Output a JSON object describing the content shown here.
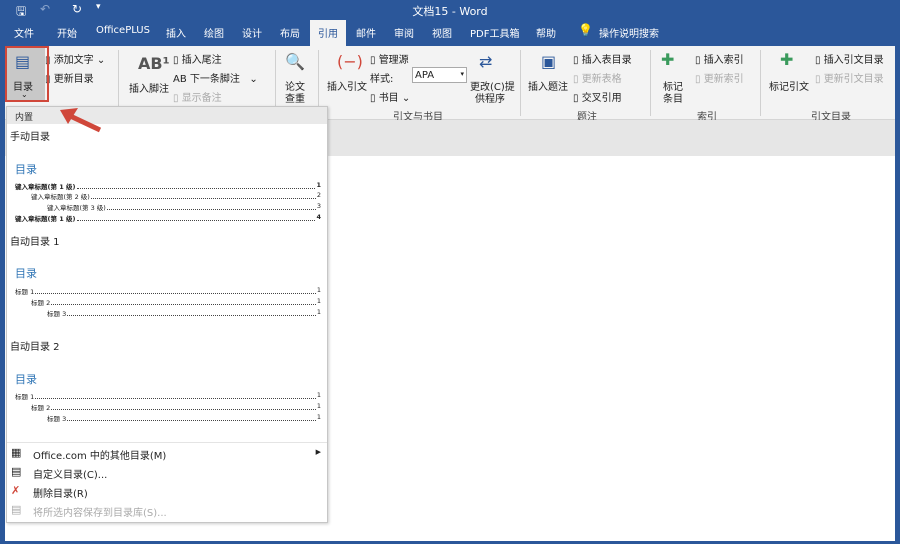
{
  "window": {
    "title": "文档15  -  Word"
  },
  "quick_access": {
    "save": "save-icon",
    "undo": "undo-icon",
    "redo": "redo-icon",
    "customize": "customize-icon"
  },
  "tabs": [
    "文件",
    "开始",
    "OfficePLUS",
    "插入",
    "绘图",
    "设计",
    "布局",
    "引用",
    "邮件",
    "审阅",
    "视图",
    "PDF工具箱",
    "帮助"
  ],
  "active_tab": "引用",
  "search_label": "操作说明搜索",
  "ribbon": {
    "toc": {
      "label": "目录",
      "add_text": "添加文字",
      "update": "更新目录"
    },
    "footnotes": {
      "insert_footnote": "插入脚注",
      "insert_endnote": "插入尾注",
      "next_footnote": "下一条脚注",
      "show_notes": "显示备注"
    },
    "research": {
      "label_1": "论文",
      "label_2": "查重"
    },
    "citations": {
      "insert_citation": "插入引文",
      "manage_sources": "管理源",
      "style_label": "样式:",
      "style_value": "APA",
      "bibliography": "书目",
      "change_1": "更改(C)提",
      "change_2": "供程序",
      "group": "引文与书目"
    },
    "captions": {
      "insert_caption": "插入题注",
      "insert_table_figures": "插入表目录",
      "update_table": "更新表格",
      "cross_ref": "交叉引用",
      "group": "题注"
    },
    "index": {
      "mark_1": "标记",
      "mark_2": "条目",
      "insert_index": "插入索引",
      "update_index": "更新索引",
      "group": "索引"
    },
    "authorities": {
      "mark_citation": "标记引文",
      "insert_toa": "插入引文目录",
      "update_toa": "更新引文目录",
      "group": "引文目录"
    }
  },
  "dropdown": {
    "header": "内置",
    "manual": {
      "name": "手动目录",
      "heading": "目录",
      "lines": [
        {
          "t": "键入章标题(第 1 级)",
          "p": "1"
        },
        {
          "t": "键入章标题(第 2 级)",
          "p": "2"
        },
        {
          "t": "键入章标题(第 3 级)",
          "p": "3"
        },
        {
          "t": "键入章标题(第 1 级)",
          "p": "4"
        }
      ]
    },
    "auto1": {
      "name": "自动目录 1",
      "heading": "目录",
      "lines": [
        {
          "t": "标题 1",
          "p": "1"
        },
        {
          "t": "标题 2",
          "p": "1"
        },
        {
          "t": "标题 3",
          "p": "1"
        }
      ]
    },
    "auto2": {
      "name": "自动目录 2",
      "heading": "目录",
      "lines": [
        {
          "t": "标题 1",
          "p": "1"
        },
        {
          "t": "标题 2",
          "p": "1"
        },
        {
          "t": "标题 3",
          "p": "1"
        }
      ]
    },
    "menu": [
      "Office.com 中的其他目录(M)",
      "自定义目录(C)...",
      "删除目录(R)",
      "将所选内容保存到目录库(S)..."
    ]
  },
  "colors": {
    "brand": "#2b579a",
    "highlight": "#d0473a"
  }
}
